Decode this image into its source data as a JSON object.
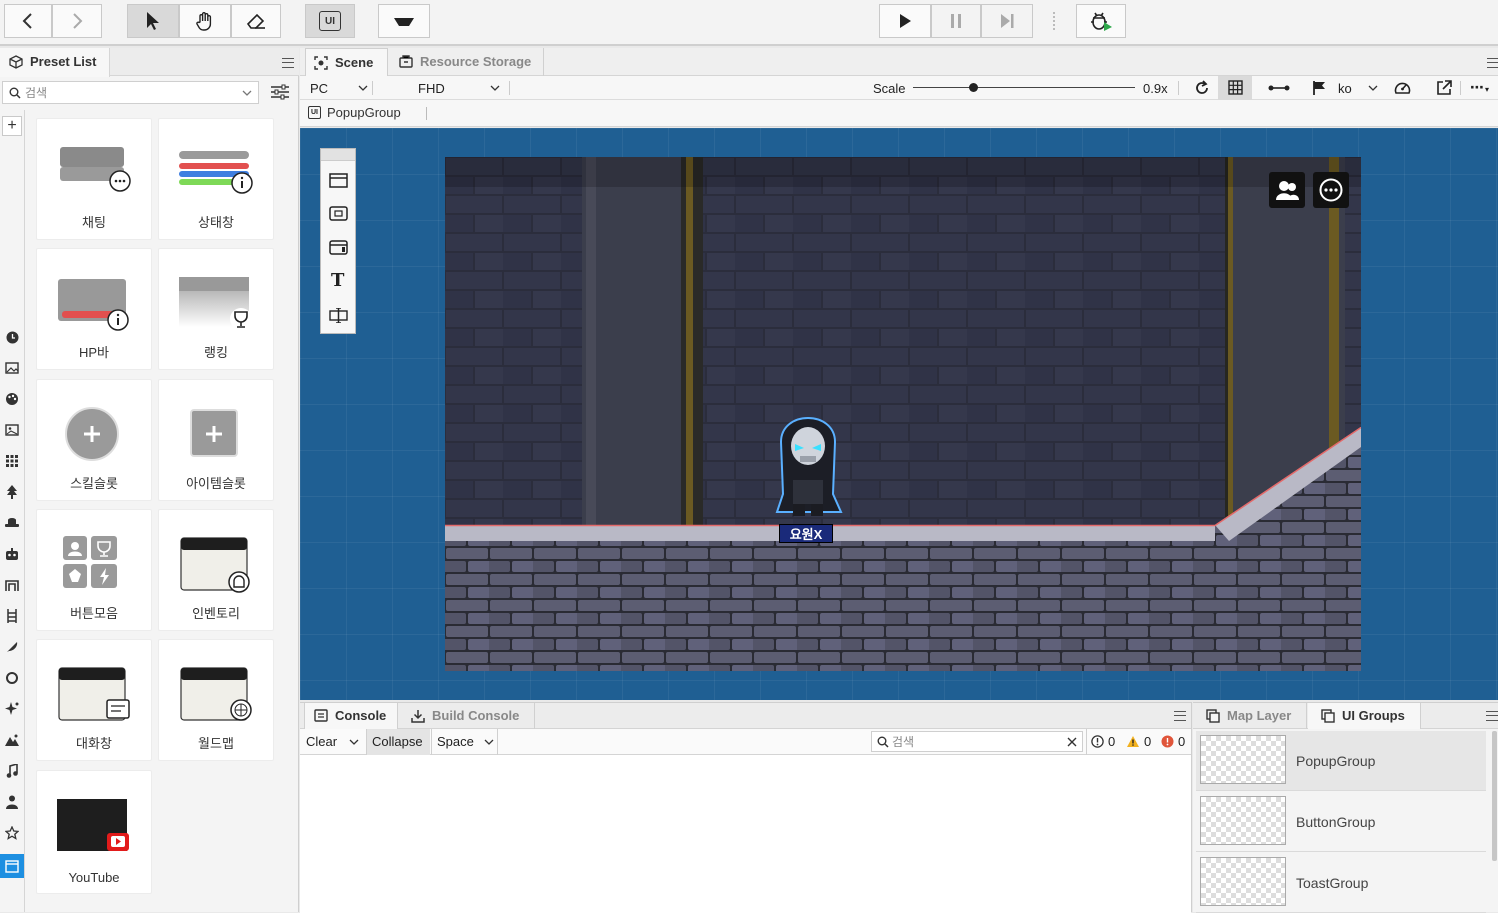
{
  "toolbar": {
    "back_label": "Back",
    "forward_label": "Forward",
    "ui_mode_label": "UI"
  },
  "preset_panel": {
    "title": "Preset List",
    "search_placeholder": "검색",
    "presets": [
      {
        "label": "채팅"
      },
      {
        "label": "상태창"
      },
      {
        "label": "HP바"
      },
      {
        "label": "랭킹"
      },
      {
        "label": "스킬슬롯"
      },
      {
        "label": "아이템슬롯"
      },
      {
        "label": "버튼모음"
      },
      {
        "label": "인벤토리"
      },
      {
        "label": "대화창"
      },
      {
        "label": "월드맵"
      },
      {
        "label": "YouTube"
      }
    ]
  },
  "scene": {
    "tabs": [
      {
        "label": "Scene"
      },
      {
        "label": "Resource Storage"
      }
    ],
    "platform": "PC",
    "resolution": "FHD",
    "scale_label": "Scale",
    "scale_value": "0.9x",
    "scale_fraction": 0.27,
    "language": "ko",
    "breadcrumb": "PopupGroup",
    "character_name": "요원X"
  },
  "console": {
    "tabs": [
      {
        "label": "Console"
      },
      {
        "label": "Build Console"
      }
    ],
    "clear_label": "Clear",
    "collapse_label": "Collapse",
    "space_label": "Space",
    "search_placeholder": "검색",
    "info_count": "0",
    "warning_count": "0",
    "error_count": "0"
  },
  "right_panel": {
    "tabs": [
      {
        "label": "Map Layer"
      },
      {
        "label": "UI Groups"
      }
    ],
    "groups": [
      {
        "name": "PopupGroup"
      },
      {
        "name": "ButtonGroup"
      },
      {
        "name": "ToastGroup"
      }
    ]
  },
  "colors": {
    "viewport_bg": "#1f5f93",
    "accent_blue": "#1d8fe1",
    "hp_red": "#e2504f"
  }
}
